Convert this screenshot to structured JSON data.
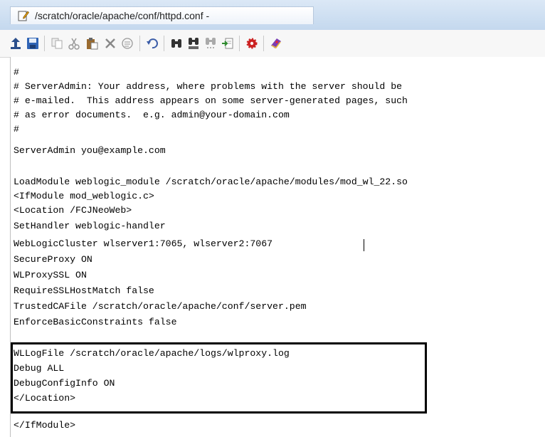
{
  "window": {
    "title": "/scratch/oracle/apache/conf/httpd.conf -",
    "title_icon": "edit-document-icon"
  },
  "toolbar": {
    "buttons": [
      {
        "name": "upload-button",
        "icon": "upload-icon"
      },
      {
        "name": "save-button",
        "icon": "floppy-disk-icon"
      },
      {
        "name": "copy-button",
        "icon": "copy-icon"
      },
      {
        "name": "cut-button",
        "icon": "scissors-icon"
      },
      {
        "name": "paste-button",
        "icon": "clipboard-icon"
      },
      {
        "name": "delete-button",
        "icon": "x-icon"
      },
      {
        "name": "select-all-button",
        "icon": "select-all-icon"
      },
      {
        "name": "undo-button",
        "icon": "undo-icon"
      },
      {
        "name": "find-button",
        "icon": "binoculars-icon"
      },
      {
        "name": "find-replace-button",
        "icon": "find-replace-icon"
      },
      {
        "name": "find-next-button",
        "icon": "find-next-icon"
      },
      {
        "name": "goto-button",
        "icon": "goto-page-icon"
      },
      {
        "name": "settings-button",
        "icon": "gear-icon"
      },
      {
        "name": "help-button",
        "icon": "book-icon"
      }
    ]
  },
  "editor": {
    "lines": [
      "#",
      "# ServerAdmin: Your address, where problems with the server should be",
      "# e-mailed.  This address appears on some server-generated pages, such",
      "# as error documents.  e.g. admin@your-domain.com",
      "#",
      "ServerAdmin you@example.com",
      "",
      "LoadModule weblogic_module /scratch/oracle/apache/modules/mod_wl_22.so",
      "<IfModule mod_weblogic.c>",
      "<Location /FCJNeoWeb>",
      "SetHandler weblogic-handler",
      "WebLogicCluster wlserver1:7065, wlserver2:7067",
      "SecureProxy ON",
      "WLProxySSL ON",
      "RequireSSLHostMatch false",
      "TrustedCAFile /scratch/oracle/apache/conf/server.pem",
      "EnforceBasicConstraints false",
      "",
      "WLLogFile /scratch/oracle/apache/logs/wlproxy.log",
      "Debug ALL",
      "DebugConfigInfo ON",
      "</Location>",
      "",
      "</IfModule>"
    ]
  }
}
